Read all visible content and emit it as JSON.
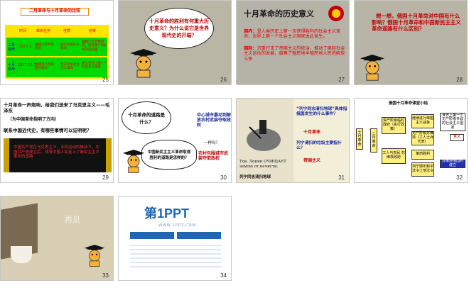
{
  "slides": [
    {
      "num": "25",
      "title": "二月革命与十月革命的比较",
      "headers": [
        "",
        "时间",
        "革命任务",
        "性质",
        "结果"
      ],
      "rows": [
        {
          "label": "二月革命",
          "time": "1917.3",
          "task": "推翻沙皇专制统治",
          "nature": "资产阶级民主革命",
          "result": "推翻沙皇专制制度，出现两个政权并存的局面"
        },
        {
          "label": "十月革命",
          "time": "1917.11.7",
          "task": "推翻资产阶级临时政府",
          "nature": "无产阶级社会主义革命",
          "result": "建立世界上第一个社会主义国家"
        }
      ]
    },
    {
      "num": "26",
      "bubble": "十月革命的胜利有何重大历史意义？为什么说它是世界现代史的开端？"
    },
    {
      "num": "27",
      "title": "十月革命的历史意义",
      "points": [
        {
          "label": "国内：",
          "text": "是人类历史上第一次获得胜利的社会主义革命；世界上第一个社会主义国家由此诞生。"
        },
        {
          "label": "国际：",
          "text": "沉重打击了帝国主义的统治，推动了国际社会主义运动的发展，鼓舞了殖民地半殖民地人民的解放斗争"
        }
      ]
    },
    {
      "num": "28",
      "text": "想一想，俄国十月革命对中国有什么影响？俄国十月革命和中国新民主主义革命道路有什么区别？"
    },
    {
      "num": "29",
      "quote": "十月革命一声炮响，给我们送来了马克思主义——毛泽东",
      "note": "（为中国革命指明了方向）",
      "question": "联系中国近代史，有哪些事情可以证明呢？",
      "scroll": "中国共产党在马克思主义、五四运动的推动下，中国共产党成立后，领导中国人民走上了新民主主义革命的道路"
    },
    {
      "num": "30",
      "bubble": "十月革命的道路是什么？",
      "q2": "中国新民主主义革命取得胜利的道路是怎样的？",
      "a1": "中心城市暴动到解放农村武装夺取政权",
      "a2": "农村包围城市武装夺取政权",
      "hint": "一样吗？"
    },
    {
      "num": "31",
      "q1": "“列宁同志清扫地球”具体指俄国发生的什么事件？",
      "a1": "十月革命",
      "q2": "列宁清扫的垃圾主要指什么？",
      "a2": "帝国主义",
      "russian": "Тов. Ленин ОЧИЩАЕТ землю от нечисти.",
      "caption": "列宁同志清扫地球"
    },
    {
      "num": "32",
      "title": "俄国十月革命课堂小结",
      "label_feb": "二月革命",
      "label_oct": "十月革命",
      "box1": "资产阶级临时政府（执行政策）",
      "box2": "继续进行帝国主义战争",
      "box3": "无产阶级苏维埃（工人士兵代表）",
      "box4": "革命胜利",
      "box5": "工人与农民 苏维埃政府",
      "box6": "列宁颁布和平法令土地法令",
      "box7": "世界上第一个无产阶级专政的社会主义国家",
      "box8": "意义",
      "extra": "苏维埃俄国的建立"
    },
    {
      "num": "33",
      "text": "再见"
    },
    {
      "num": "34",
      "brand": "第1PPT",
      "sub": "WWW.1PPT.COM"
    }
  ]
}
